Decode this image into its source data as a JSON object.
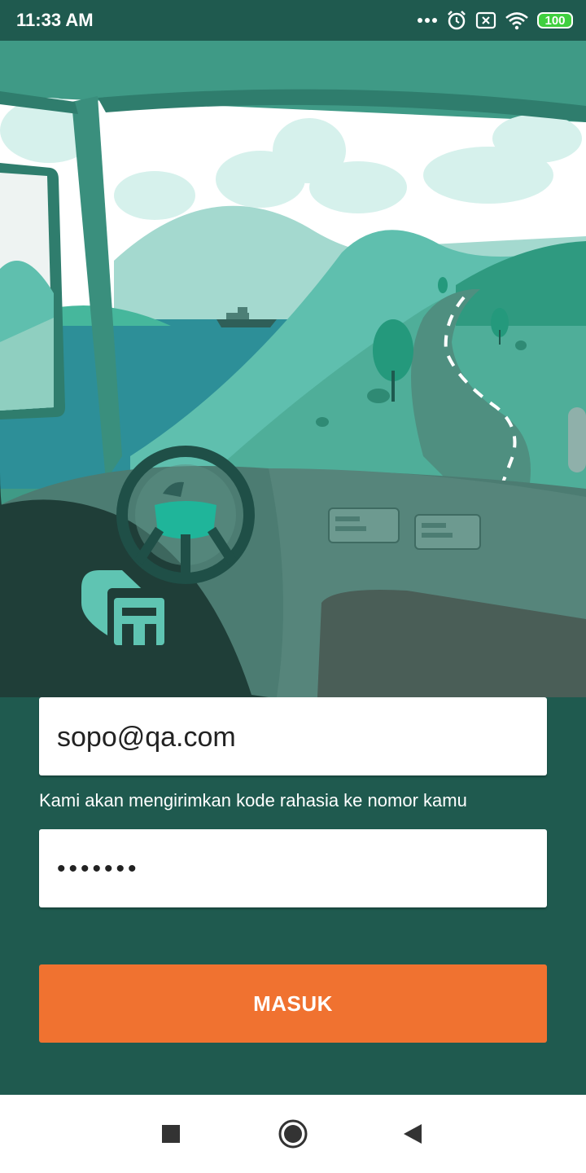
{
  "status_bar": {
    "time": "11:33 AM",
    "icons": [
      "more-dots-icon",
      "alarm-icon",
      "sim-error-icon",
      "wifi-icon",
      "battery-icon"
    ],
    "battery": "100"
  },
  "colors": {
    "background": "#1f5a4f",
    "accent_button": "#f07230",
    "field_background": "#ffffff"
  },
  "login": {
    "email_value": "sopo@qa.com",
    "helper_text": "Kami akan mengirimkan kode rahasia ke nomor kamu",
    "password_value": "•••••••",
    "submit_label": "MASUK"
  },
  "nav_bar": {
    "icons": [
      "recents-square-icon",
      "home-circle-icon",
      "back-triangle-icon"
    ]
  }
}
